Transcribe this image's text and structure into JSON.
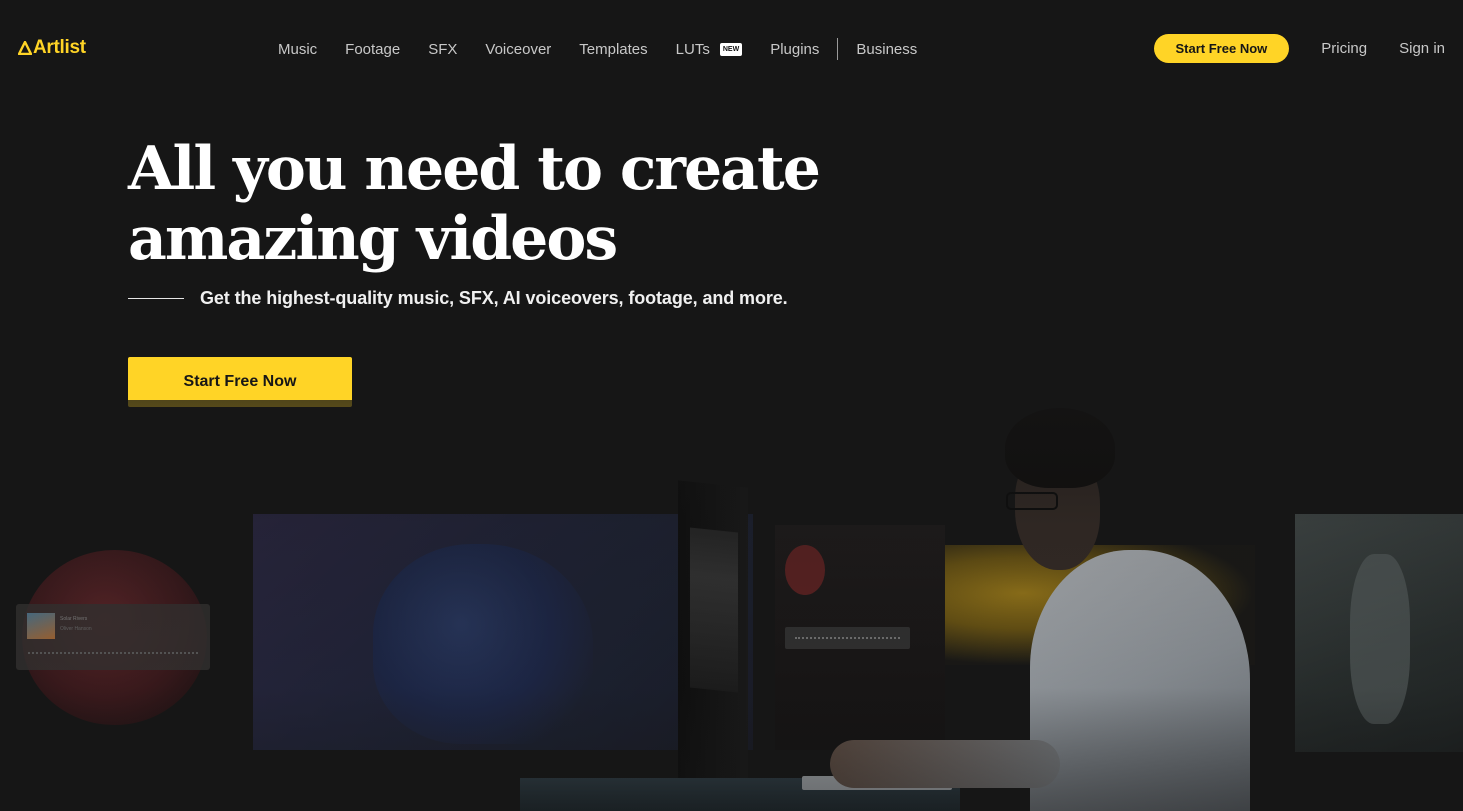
{
  "brand": {
    "name": "Artlist",
    "accent": "#ffd426",
    "background": "#161616"
  },
  "nav": {
    "items": [
      {
        "label": "Music"
      },
      {
        "label": "Footage"
      },
      {
        "label": "SFX"
      },
      {
        "label": "Voiceover"
      },
      {
        "label": "Templates"
      },
      {
        "label": "LUTs",
        "badge": "NEW"
      },
      {
        "label": "Plugins"
      },
      {
        "label": "Business"
      }
    ],
    "cta_label": "Start Free Now",
    "pricing_label": "Pricing",
    "signin_label": "Sign in"
  },
  "hero": {
    "title": "All you need to create amazing videos",
    "subtitle": "Get the highest-quality music, SFX, AI voiceovers, footage, and more.",
    "cta_label": "Start Free Now"
  },
  "showcase": {
    "music_card": {
      "title": "Solar Rivers",
      "artist": "Oliver Hanson"
    }
  }
}
